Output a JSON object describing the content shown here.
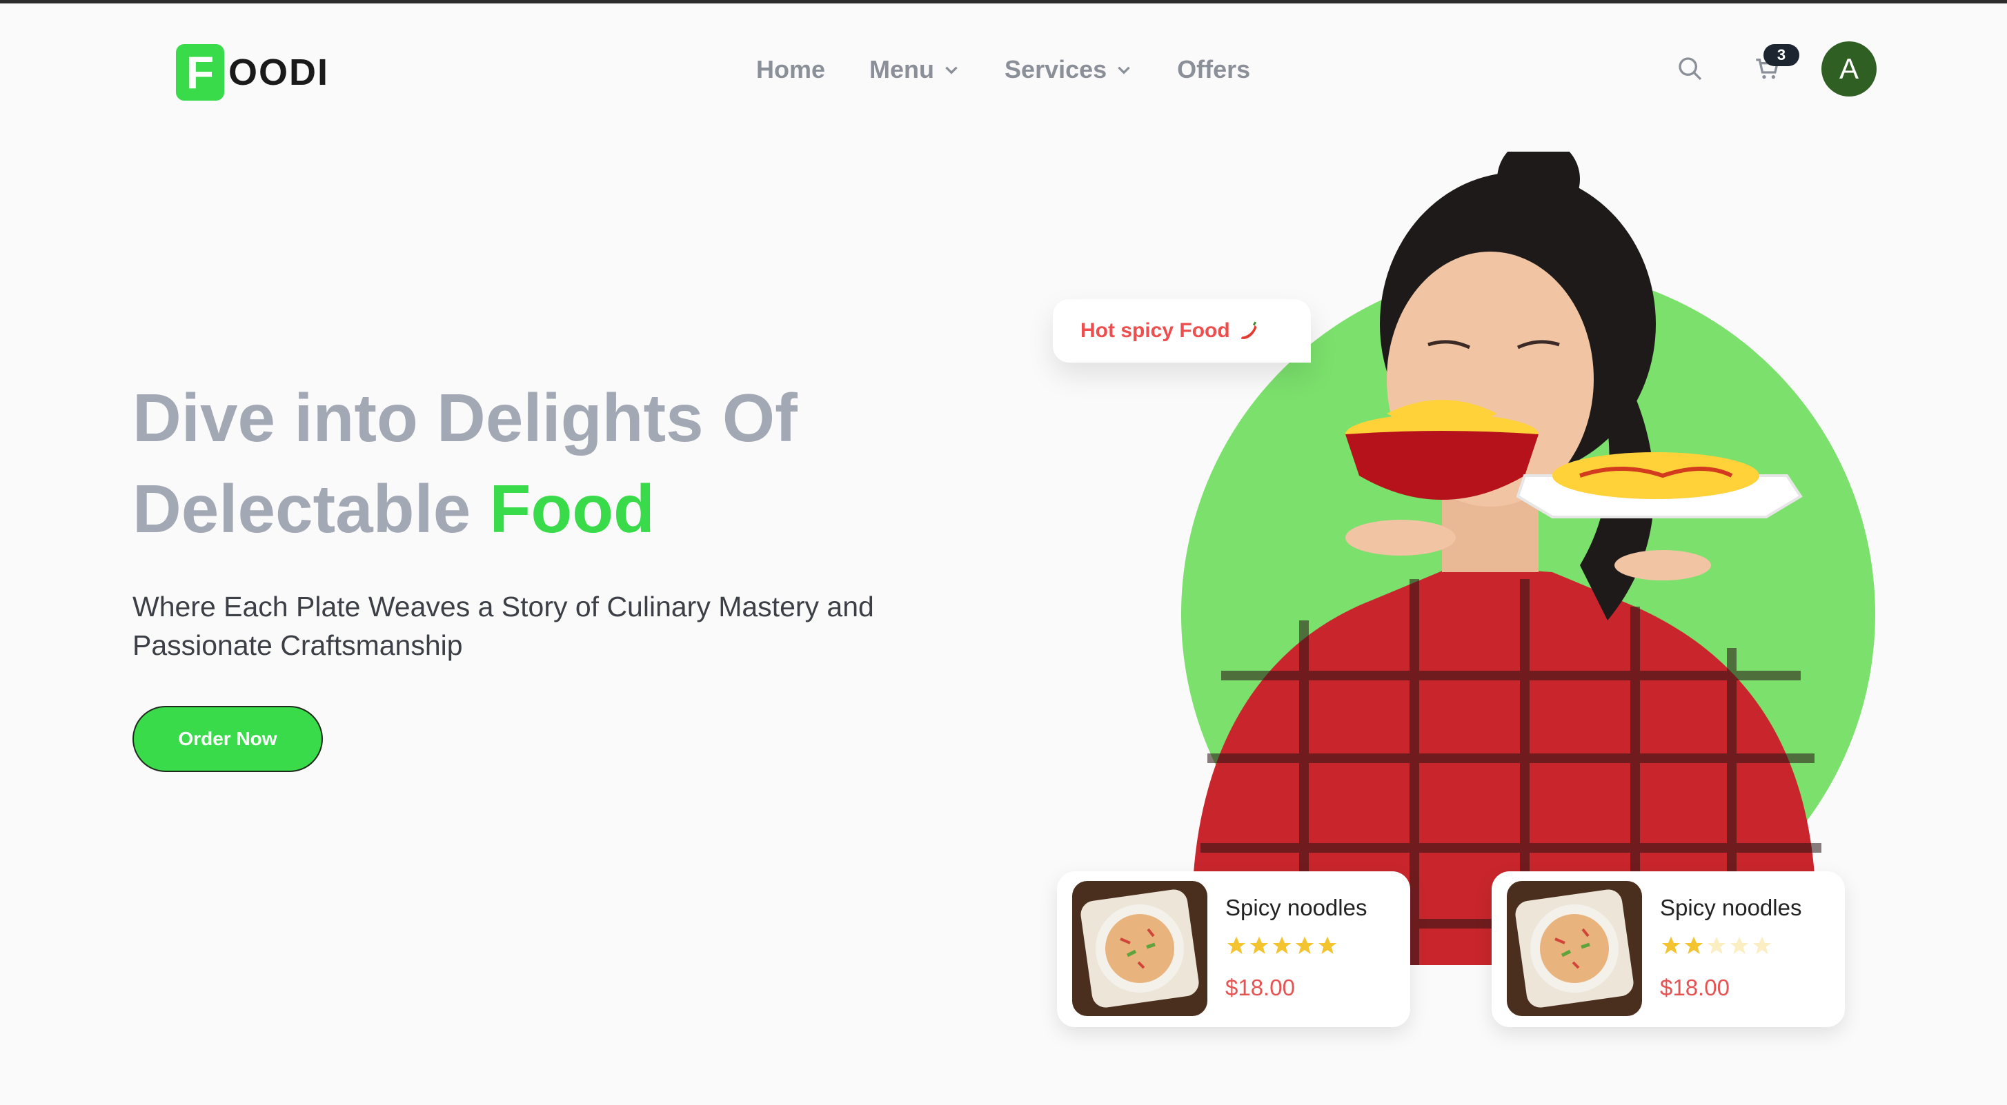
{
  "brand": {
    "logo_letter": "F",
    "logo_text": "OODI",
    "accent_color": "#39db4a"
  },
  "nav": {
    "items": [
      {
        "label": "Home",
        "has_dropdown": false
      },
      {
        "label": "Menu",
        "has_dropdown": true
      },
      {
        "label": "Services",
        "has_dropdown": true
      },
      {
        "label": "Offers",
        "has_dropdown": false
      }
    ]
  },
  "header_actions": {
    "search_icon": "search-icon",
    "cart_icon": "cart-icon",
    "cart_count": "3",
    "avatar_initial": "A"
  },
  "hero": {
    "title_line1": "Dive into Delights Of",
    "title_line2_prefix": "Delectable ",
    "title_line2_accent": "Food",
    "subtitle": "Where Each Plate Weaves a Story of Culinary Mastery and Passionate Craftsmanship",
    "cta_label": "Order Now"
  },
  "bubble": {
    "text": "Hot spicy Food",
    "icon": "chili-pepper-icon"
  },
  "cards": [
    {
      "name": "Spicy noodles",
      "rating": 5,
      "max_rating": 5,
      "price": "$18.00"
    },
    {
      "name": "Spicy noodles",
      "rating": 2,
      "max_rating": 5,
      "price": "$18.00"
    }
  ]
}
